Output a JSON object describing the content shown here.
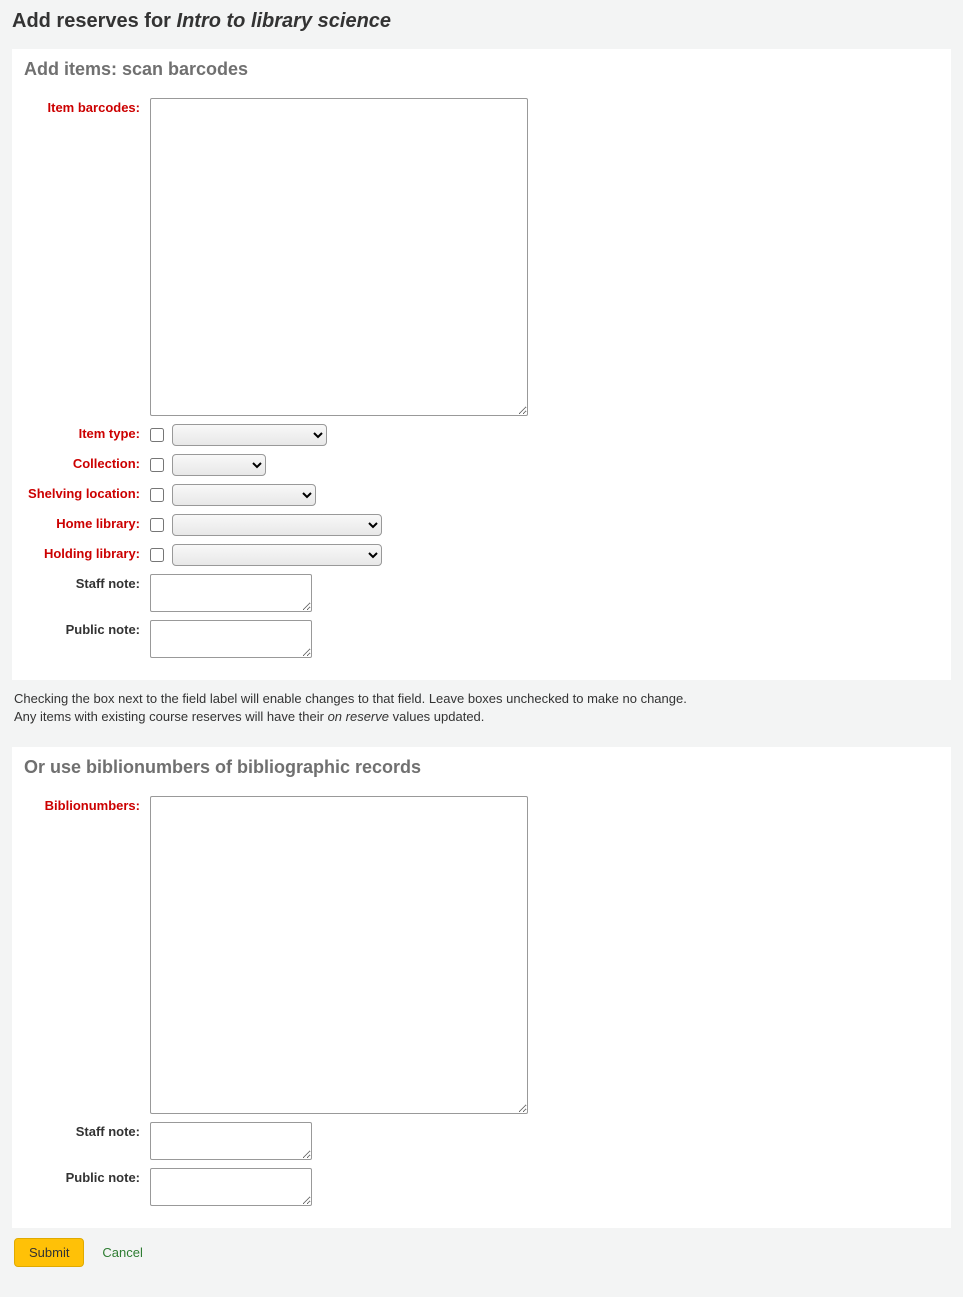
{
  "page": {
    "title_prefix": "Add reserves for ",
    "course_name": "Intro to library science"
  },
  "panel1": {
    "heading": "Add items: scan barcodes",
    "fields": {
      "barcodes_label": "Item barcodes:",
      "itemtype_label": "Item type:",
      "collection_label": "Collection:",
      "shelving_label": "Shelving location:",
      "homelib_label": "Home library:",
      "holdlib_label": "Holding library:",
      "staffnote_label": "Staff note:",
      "publicnote_label": "Public note:"
    }
  },
  "hint": {
    "line1": "Checking the box next to the field label will enable changes to that field. Leave boxes unchecked to make no change.",
    "line2a": "Any items with existing course reserves will have their ",
    "line2_italic": "on reserve",
    "line2b": " values updated."
  },
  "panel2": {
    "heading": "Or use biblionumbers of bibliographic records",
    "fields": {
      "biblionumbers_label": "Biblionumbers:",
      "staffnote_label": "Staff note:",
      "publicnote_label": "Public note:"
    }
  },
  "actions": {
    "submit": "Submit",
    "cancel": "Cancel"
  }
}
